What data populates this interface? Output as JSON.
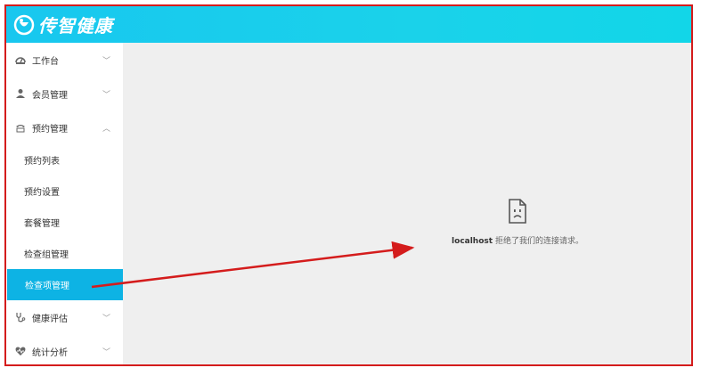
{
  "brand": {
    "name": "传智健康"
  },
  "sidebar": {
    "items": [
      {
        "label": "工作台",
        "icon": "dashboard-icon",
        "chevron": "chevron-down-icon"
      },
      {
        "label": "会员管理",
        "icon": "user-icon",
        "chevron": "chevron-down-icon"
      },
      {
        "label": "预约管理",
        "icon": "phone-icon",
        "chevron": "chevron-up-icon"
      },
      {
        "label": "健康评估",
        "icon": "stethoscope-icon",
        "chevron": "chevron-down-icon"
      },
      {
        "label": "统计分析",
        "icon": "heart-pulse-icon",
        "chevron": "chevron-down-icon"
      }
    ],
    "subitems": [
      {
        "label": "预约列表"
      },
      {
        "label": "预约设置"
      },
      {
        "label": "套餐管理"
      },
      {
        "label": "检查组管理"
      },
      {
        "label": "检查项管理",
        "active": true
      }
    ]
  },
  "error": {
    "host": "localhost",
    "message": "拒绝了我们的连接请求。",
    "icon": "sad-page-icon"
  },
  "colors": {
    "header": "#18c7ef",
    "active_item": "#0db3e4",
    "frame_border": "#d41c1c",
    "annotation_arrow": "#d41c1c"
  }
}
